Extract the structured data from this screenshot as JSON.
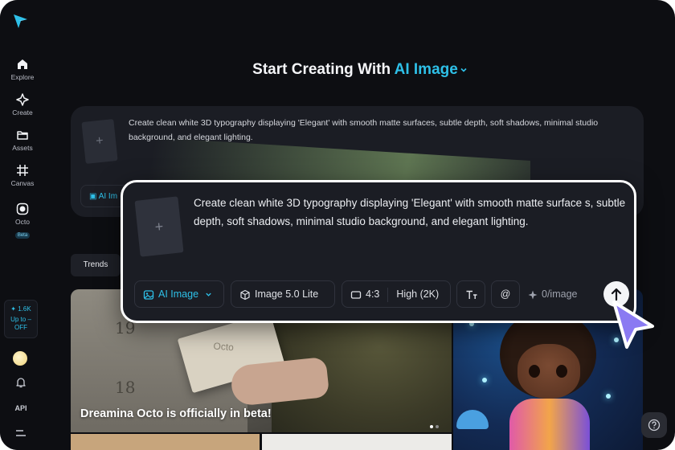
{
  "sidebar": {
    "items": [
      {
        "label": "Explore",
        "icon": "home-icon"
      },
      {
        "label": "Create",
        "icon": "sparkle-icon"
      },
      {
        "label": "Assets",
        "icon": "folder-icon"
      },
      {
        "label": "Canvas",
        "icon": "frame-icon"
      },
      {
        "label": "Octo",
        "icon": "octo-icon",
        "badge": "Beta"
      }
    ],
    "promo": {
      "count": "1.6K",
      "text": "Up to – OFF"
    },
    "api_label": "API"
  },
  "header": {
    "title_prefix": "Start Creating With",
    "title_accent": "AI Image"
  },
  "background_prompt": {
    "text": "Create clean white 3D typography displaying 'Elegant' with smooth matte surfaces, subtle depth, soft shadows, minimal studio background, and elegant lighting.",
    "chip_label": "AI Im"
  },
  "tabs": {
    "trends": "Trends"
  },
  "gallery": {
    "banner_caption": "Dreamina Octo is officially in beta!",
    "envelope_text": "Octo",
    "mailbox_numbers": [
      "19",
      "18"
    ]
  },
  "composer": {
    "prompt_text": "Create clean white 3D typography displaying 'Elegant' with smooth matte surface s, subtle depth, soft shadows, minimal studio background, and elegant lighting.",
    "mode_label": "AI Image",
    "model_label": "Image 5.0 Lite",
    "ratio_label": "4:3",
    "quality_label": "High (2K)",
    "mention_symbol": "@",
    "credits_label": "0/image"
  },
  "colors": {
    "accent": "#2ec0e8",
    "background": "#0d0e12",
    "panel": "#1b1d24"
  }
}
